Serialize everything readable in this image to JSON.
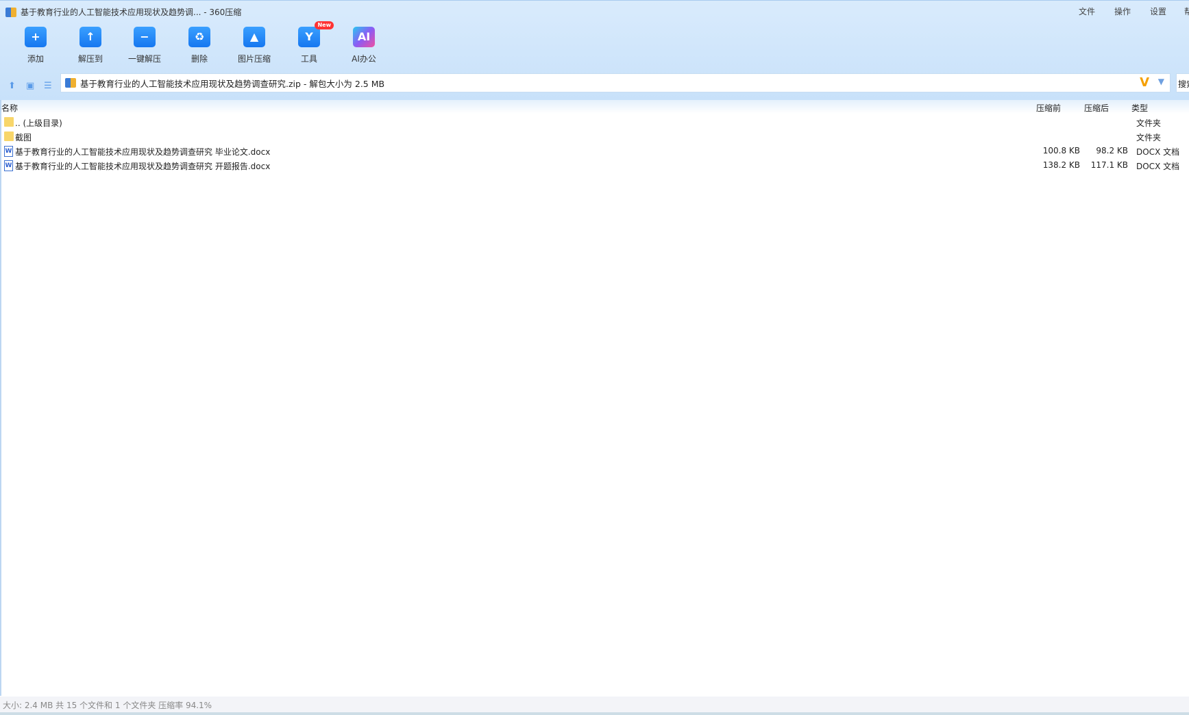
{
  "window": {
    "title": "基于教育行业的人工智能技术应用现状及趋势调... - 360压缩"
  },
  "menu": [
    "文件",
    "操作",
    "设置",
    "帮"
  ],
  "toolbar": [
    {
      "label": "添加",
      "icon": "add-folder-icon",
      "glyph": "+"
    },
    {
      "label": "解压到",
      "icon": "extract-to-icon",
      "glyph": "↑"
    },
    {
      "label": "一键解压",
      "icon": "one-click-extract-icon",
      "glyph": "−"
    },
    {
      "label": "删除",
      "icon": "delete-bin-icon",
      "glyph": "♻"
    },
    {
      "label": "图片压缩",
      "icon": "image-compress-icon",
      "glyph": "▲"
    },
    {
      "label": "工具",
      "icon": "tools-icon",
      "glyph": "Y",
      "badge": "New"
    },
    {
      "label": "AI办公",
      "icon": "ai-office-icon",
      "glyph": "AI"
    }
  ],
  "address": {
    "path": "基于教育行业的人工智能技术应用现状及趋势调查研究.zip - 解包大小为 2.5 MB",
    "search_placeholder": "搜索"
  },
  "columns": {
    "name": "名称",
    "before": "压缩前",
    "after": "压缩后",
    "type": "类型"
  },
  "files": [
    {
      "name": ".. (上级目录)",
      "before": "",
      "after": "",
      "type": "文件夹",
      "kind": "folder"
    },
    {
      "name": "截图",
      "before": "",
      "after": "",
      "type": "文件夹",
      "kind": "folder"
    },
    {
      "name": "基于教育行业的人工智能技术应用现状及趋势调查研究 毕业论文.docx",
      "before": "100.8 KB",
      "after": "98.2 KB",
      "type": "DOCX 文档",
      "kind": "docx"
    },
    {
      "name": "基于教育行业的人工智能技术应用现状及趋势调查研究 开题报告.docx",
      "before": "138.2 KB",
      "after": "117.1 KB",
      "type": "DOCX 文档",
      "kind": "docx"
    }
  ],
  "status": "大小: 2.4 MB 共 15 个文件和 1 个文件夹 压缩率 94.1%"
}
